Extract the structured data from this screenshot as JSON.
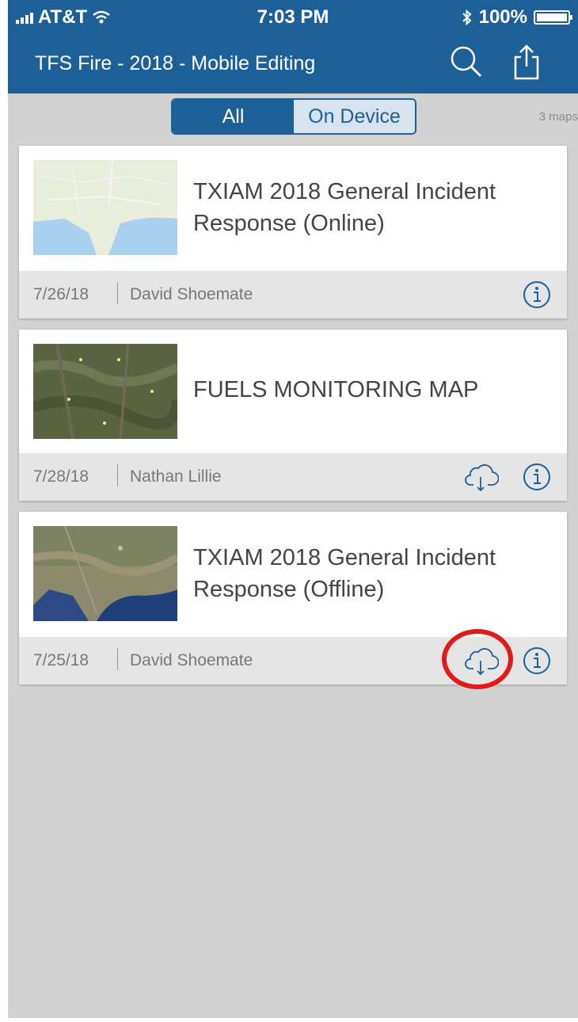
{
  "status_bar": {
    "carrier": "AT&T",
    "time": "7:03 PM",
    "battery": "100%"
  },
  "nav": {
    "title": "TFS Fire - 2018 - Mobile Editing"
  },
  "filter": {
    "tabs": [
      "All",
      "On Device"
    ],
    "selected": "All",
    "count_label": "3 maps"
  },
  "maps": [
    {
      "title": "TXIAM 2018 General Incident Response (Online)",
      "date": "7/26/18",
      "author": "David Shoemate",
      "downloadable": false
    },
    {
      "title": "FUELS MONITORING MAP",
      "date": "7/28/18",
      "author": "Nathan Lillie",
      "downloadable": true
    },
    {
      "title": "TXIAM 2018 General Incident Response (Offline)",
      "date": "7/25/18",
      "author": "David Shoemate",
      "downloadable": true
    }
  ],
  "colors": {
    "brand": "#1d5f97",
    "highlight": "#e11a1a"
  }
}
